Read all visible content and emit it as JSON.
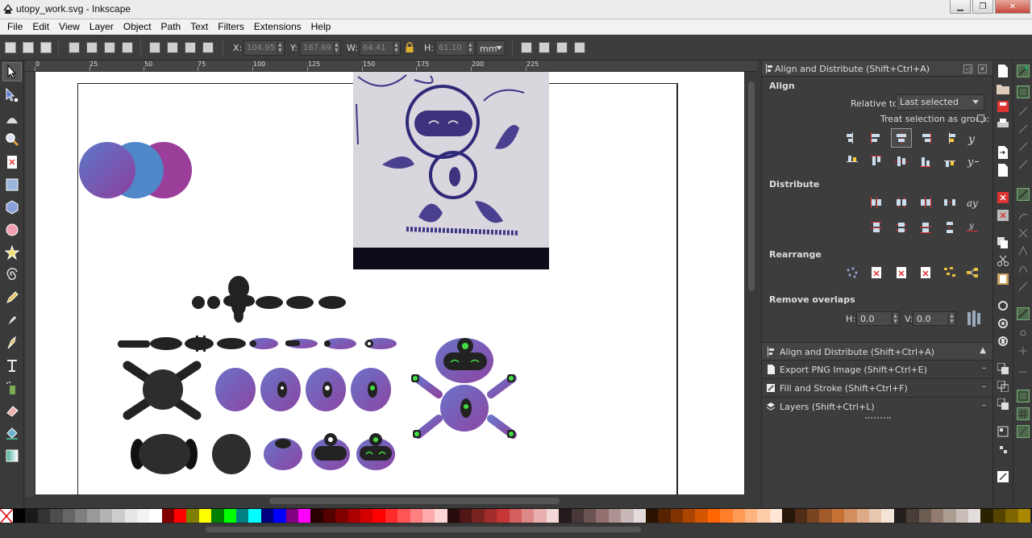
{
  "window": {
    "title": "utopy_work.svg - Inkscape",
    "controls": [
      "minimize",
      "maximize",
      "close"
    ]
  },
  "menu": [
    "File",
    "Edit",
    "View",
    "Layer",
    "Object",
    "Path",
    "Text",
    "Filters",
    "Extensions",
    "Help"
  ],
  "toolbar": {
    "x_label": "X:",
    "y_label": "Y:",
    "w_label": "W:",
    "h_label": "H:",
    "x_value": "104.95",
    "y_value": "167.69",
    "w_value": "64.41",
    "h_value": "61.10",
    "unit": "mm"
  },
  "ruler": {
    "ticks": [
      "0",
      "25",
      "50",
      "75",
      "100",
      "125",
      "150",
      "175",
      "200",
      "225"
    ]
  },
  "align_panel": {
    "title": "Align and Distribute (Shift+Ctrl+A)",
    "align_heading": "Align",
    "relative_to_label": "Relative to:",
    "relative_to_value": "Last selected",
    "treat_group_label": "Treat selection as group:",
    "distribute_heading": "Distribute",
    "rearrange_heading": "Rearrange",
    "remove_overlaps_heading": "Remove overlaps",
    "h_label": "H:",
    "h_value": "0.0",
    "v_label": "V:",
    "v_value": "0.0"
  },
  "dock_panels": [
    {
      "label": "Align and Distribute (Shift+Ctrl+A)",
      "state": "▲"
    },
    {
      "label": "Export PNG Image (Shift+Ctrl+E)",
      "state": "–"
    },
    {
      "label": "Fill and Stroke (Shift+Ctrl+F)",
      "state": "–"
    },
    {
      "label": "Layers (Shift+Ctrl+L)",
      "state": "–"
    }
  ],
  "palette": [
    "#000000",
    "#1a1a1a",
    "#333333",
    "#4d4d4d",
    "#666666",
    "#808080",
    "#999999",
    "#b3b3b3",
    "#cccccc",
    "#e6e6e6",
    "#f2f2f2",
    "#ffffff",
    "#800000",
    "#ff0000",
    "#808000",
    "#ffff00",
    "#008000",
    "#00ff00",
    "#008080",
    "#00ffff",
    "#000080",
    "#0000ff",
    "#800080",
    "#ff00ff",
    "#2b0000",
    "#550000",
    "#800000",
    "#aa0000",
    "#d40000",
    "#ff0000",
    "#ff2a2a",
    "#ff5555",
    "#ff8080",
    "#ffaaaa",
    "#ffd5d5",
    "#280b0b",
    "#501616",
    "#782121",
    "#a02c2c",
    "#c83737",
    "#d35f5f",
    "#de8787",
    "#e9afaf",
    "#f4d7d7",
    "#241c1c",
    "#483737",
    "#6c5353",
    "#916f6f",
    "#ac9393",
    "#c8b7b7",
    "#e3dbdb",
    "#2b1100",
    "#552200",
    "#803300",
    "#aa4400",
    "#d45500",
    "#ff6600",
    "#ff7f2a",
    "#ff9955",
    "#ffb380",
    "#ffccaa",
    "#ffe6d5",
    "#28170b",
    "#502d16",
    "#784421",
    "#a05a2c",
    "#c87137",
    "#d38d5f",
    "#deaa87",
    "#e9c6af",
    "#f4e3d7",
    "#241f1c",
    "#483e37",
    "#6c5d53",
    "#917c6f",
    "#ac9d93",
    "#c8beb7",
    "#e3dedb",
    "#2b2200",
    "#554400",
    "#806600",
    "#aa8800"
  ]
}
